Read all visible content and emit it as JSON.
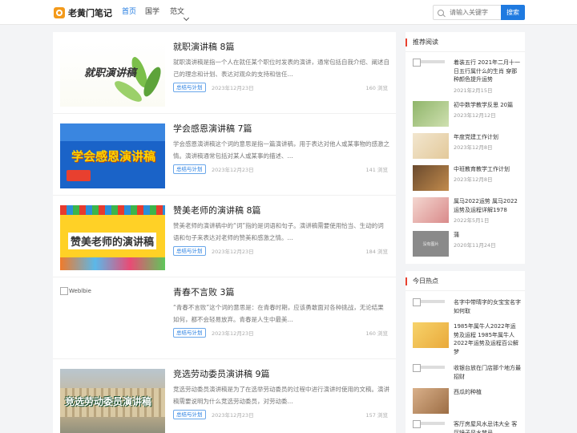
{
  "header": {
    "logo_text": "老黄门笔记",
    "nav": [
      {
        "label": "首页",
        "active": true
      },
      {
        "label": "国学",
        "active": false
      },
      {
        "label": "范文",
        "active": false
      }
    ],
    "search": {
      "placeholder": "请输入关键字",
      "button_label": "搜索"
    }
  },
  "articles": [
    {
      "title": "就职演讲稿 8篇",
      "summary": "就职演讲稿是指一个人在就任某个职位时发表的演讲，通常包括自我介绍、阐述自己的理念和计划、表达对观众的支持和信任...",
      "tag": "总结与计划",
      "date": "2023年12月23日",
      "views": "160 浏览",
      "thumb_text": "就职演讲稿"
    },
    {
      "title": "学会感恩演讲稿 7篇",
      "summary": "学会感恩演讲稿这个词的意思是指一篇演讲稿，用于表达对他人或某事物的感激之情。演讲稿通常包括对某人或某事的描述、...",
      "tag": "总结与计划",
      "date": "2023年12月23日",
      "views": "141 浏览",
      "thumb_text": "学会感恩演讲稿"
    },
    {
      "title": "赞美老师的演讲稿 8篇",
      "summary": "赞美老师的演讲稿中的“词”指的是词语和句子。演讲稿需要使用恰当、生动的词语和句子来表达对老师的赞美和感激之情。...",
      "tag": "总结与计划",
      "date": "2023年12月23日",
      "views": "184 浏览",
      "thumb_text": "赞美老师的演讲稿"
    },
    {
      "title": "青春不言败 3篇",
      "summary": "“青春不言败”这个词的意思是：在青春时期，应该勇敢面对各种挑战，无论结果如何，都不会轻易放弃。青春是人生中最美...",
      "tag": "总结与计划",
      "date": "2023年12月23日",
      "views": "160 浏览",
      "thumb_text": "Weblbie"
    },
    {
      "title": "竞选劳动委员演讲稿 9篇",
      "summary": "竞选劳动委员演讲稿是为了在选举劳动委员的过程中进行演讲时使用的文稿。演讲稿需要说明为什么竞选劳动委员，对劳动委...",
      "tag": "总结与计划",
      "date": "2023年12月23日",
      "views": "157 浏览",
      "thumb_text": "竞选劳动委员演讲稿"
    }
  ],
  "recommended": {
    "heading": "推荐阅读",
    "items": [
      {
        "title": "着装五行 2021年二月十一日五行属什么的生肖 穿那种颜色提升运势",
        "date": "2021年2月15日",
        "thumb": "broken"
      },
      {
        "title": "初中数学教学反思 20篇",
        "date": "2023年12月12日",
        "thumb": "green"
      },
      {
        "title": "年度党建工作计划",
        "date": "2023年12月8日",
        "thumb": "paper"
      },
      {
        "title": "中班教育教学工作计划",
        "date": "2023年12月8日",
        "thumb": "dark"
      },
      {
        "title": "属马2022运势 属马2022运势及运程详解1978",
        "date": "2022年5月1日",
        "thumb": "pink"
      },
      {
        "title": "蒲",
        "date": "2020年11月24日",
        "thumb": "gray",
        "thumb_text": "没有图片"
      }
    ]
  },
  "hot": {
    "heading": "今日热点",
    "items": [
      {
        "title": "名字中带晴字的女宝宝名字如何取",
        "thumb": "broken"
      },
      {
        "title": "1985年属牛人2022年运势及运程 1985年属牛人2022年运势及运程百公解梦",
        "thumb": "yellow"
      },
      {
        "title": "收银台放在门店那个地方最招财",
        "thumb": "broken"
      },
      {
        "title": "西瓜的种植",
        "thumb": "fruit"
      },
      {
        "title": "客厅房屋风水忌讳大全 客厅镜子风水禁忌",
        "thumb": "broken"
      }
    ]
  }
}
